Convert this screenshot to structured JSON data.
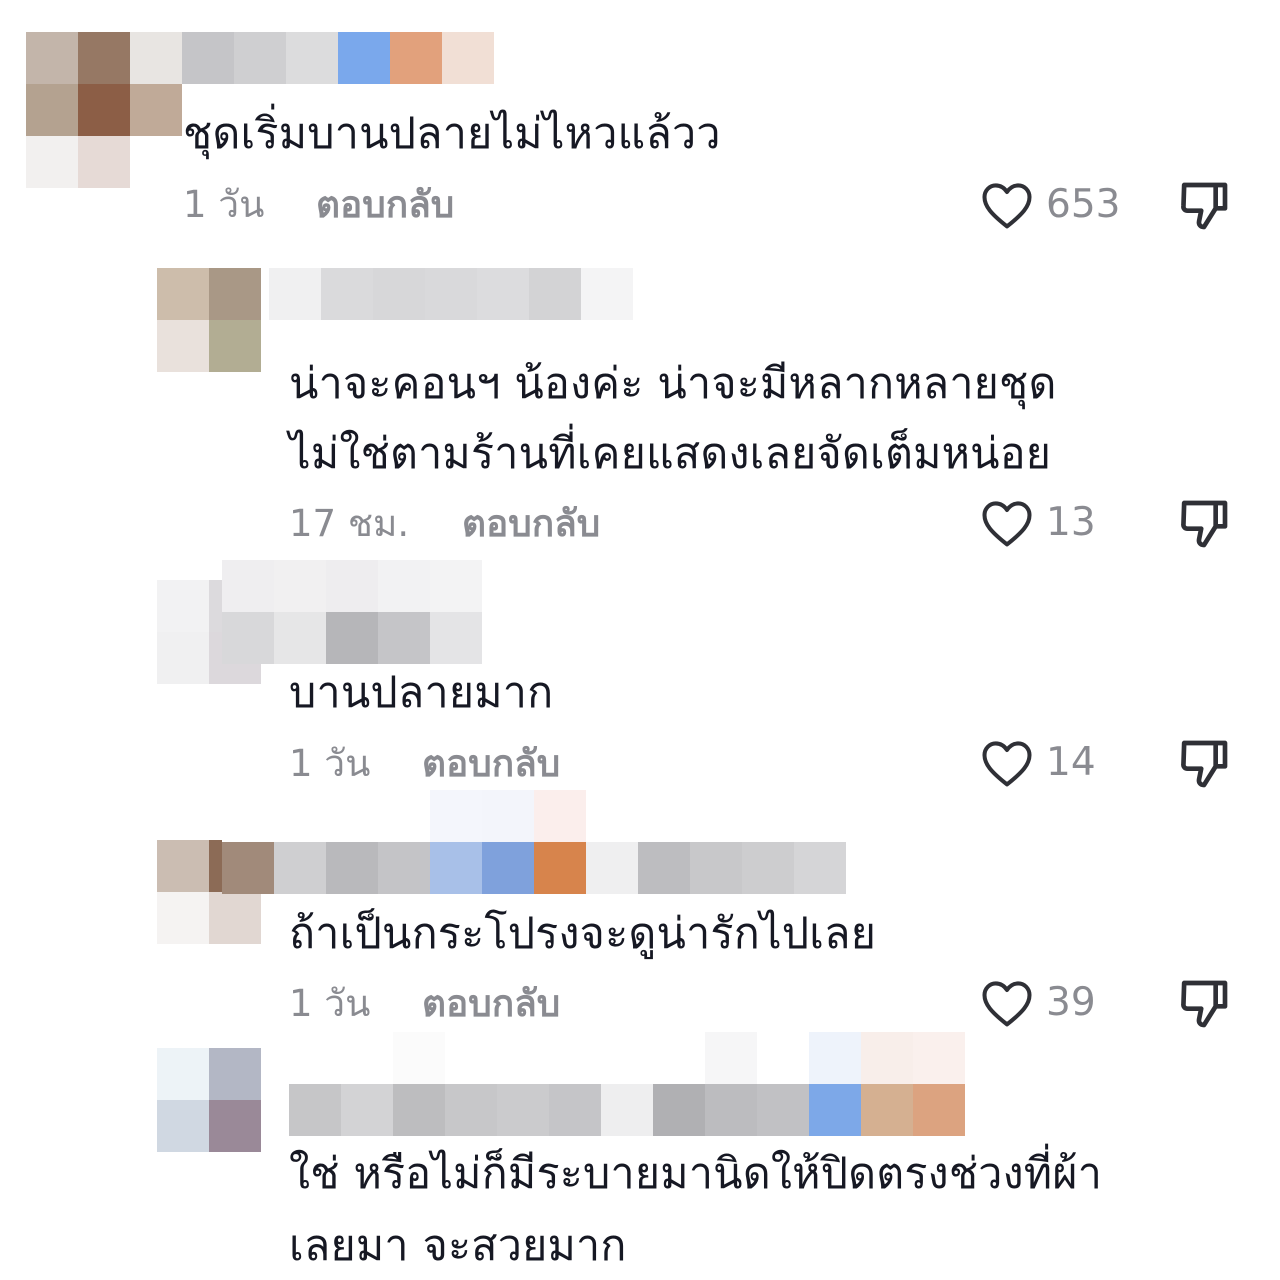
{
  "comments": [
    {
      "text_lines": [
        "ชุดเริ่มบานปลายไม่ไหวแล้วว"
      ],
      "time": "1 วัน",
      "reply_label": "ตอบกลับ",
      "likes": "653"
    },
    {
      "text_lines": [
        "น่าจะคอนฯ น้องค่ะ น่าจะมีหลากหลายชุด",
        "ไม่ใช่ตามร้านที่เคยแสดงเลยจัดเต็มหน่อย"
      ],
      "time": "17 ชม.",
      "reply_label": "ตอบกลับ",
      "likes": "13"
    },
    {
      "text_lines": [
        "บานปลายมาก"
      ],
      "time": "1 วัน",
      "reply_label": "ตอบกลับ",
      "likes": "14"
    },
    {
      "text_lines": [
        "ถ้าเป็นกระโปรงจะดูน่ารักไปเลย"
      ],
      "time": "1 วัน",
      "reply_label": "ตอบกลับ",
      "likes": "39"
    },
    {
      "text_lines": [
        "ใช่ หรือไม่ก็มีระบายมานิดให้ปิดตรงช่วงที่ผ้า",
        "เลยมา จะสวยมาก"
      ]
    }
  ],
  "icons": {
    "like": "heart-outline-icon",
    "dislike": "thumbs-down-icon"
  },
  "colors": {
    "text": "#161823",
    "muted": "#8a8b91",
    "icon": "#2f3036"
  }
}
